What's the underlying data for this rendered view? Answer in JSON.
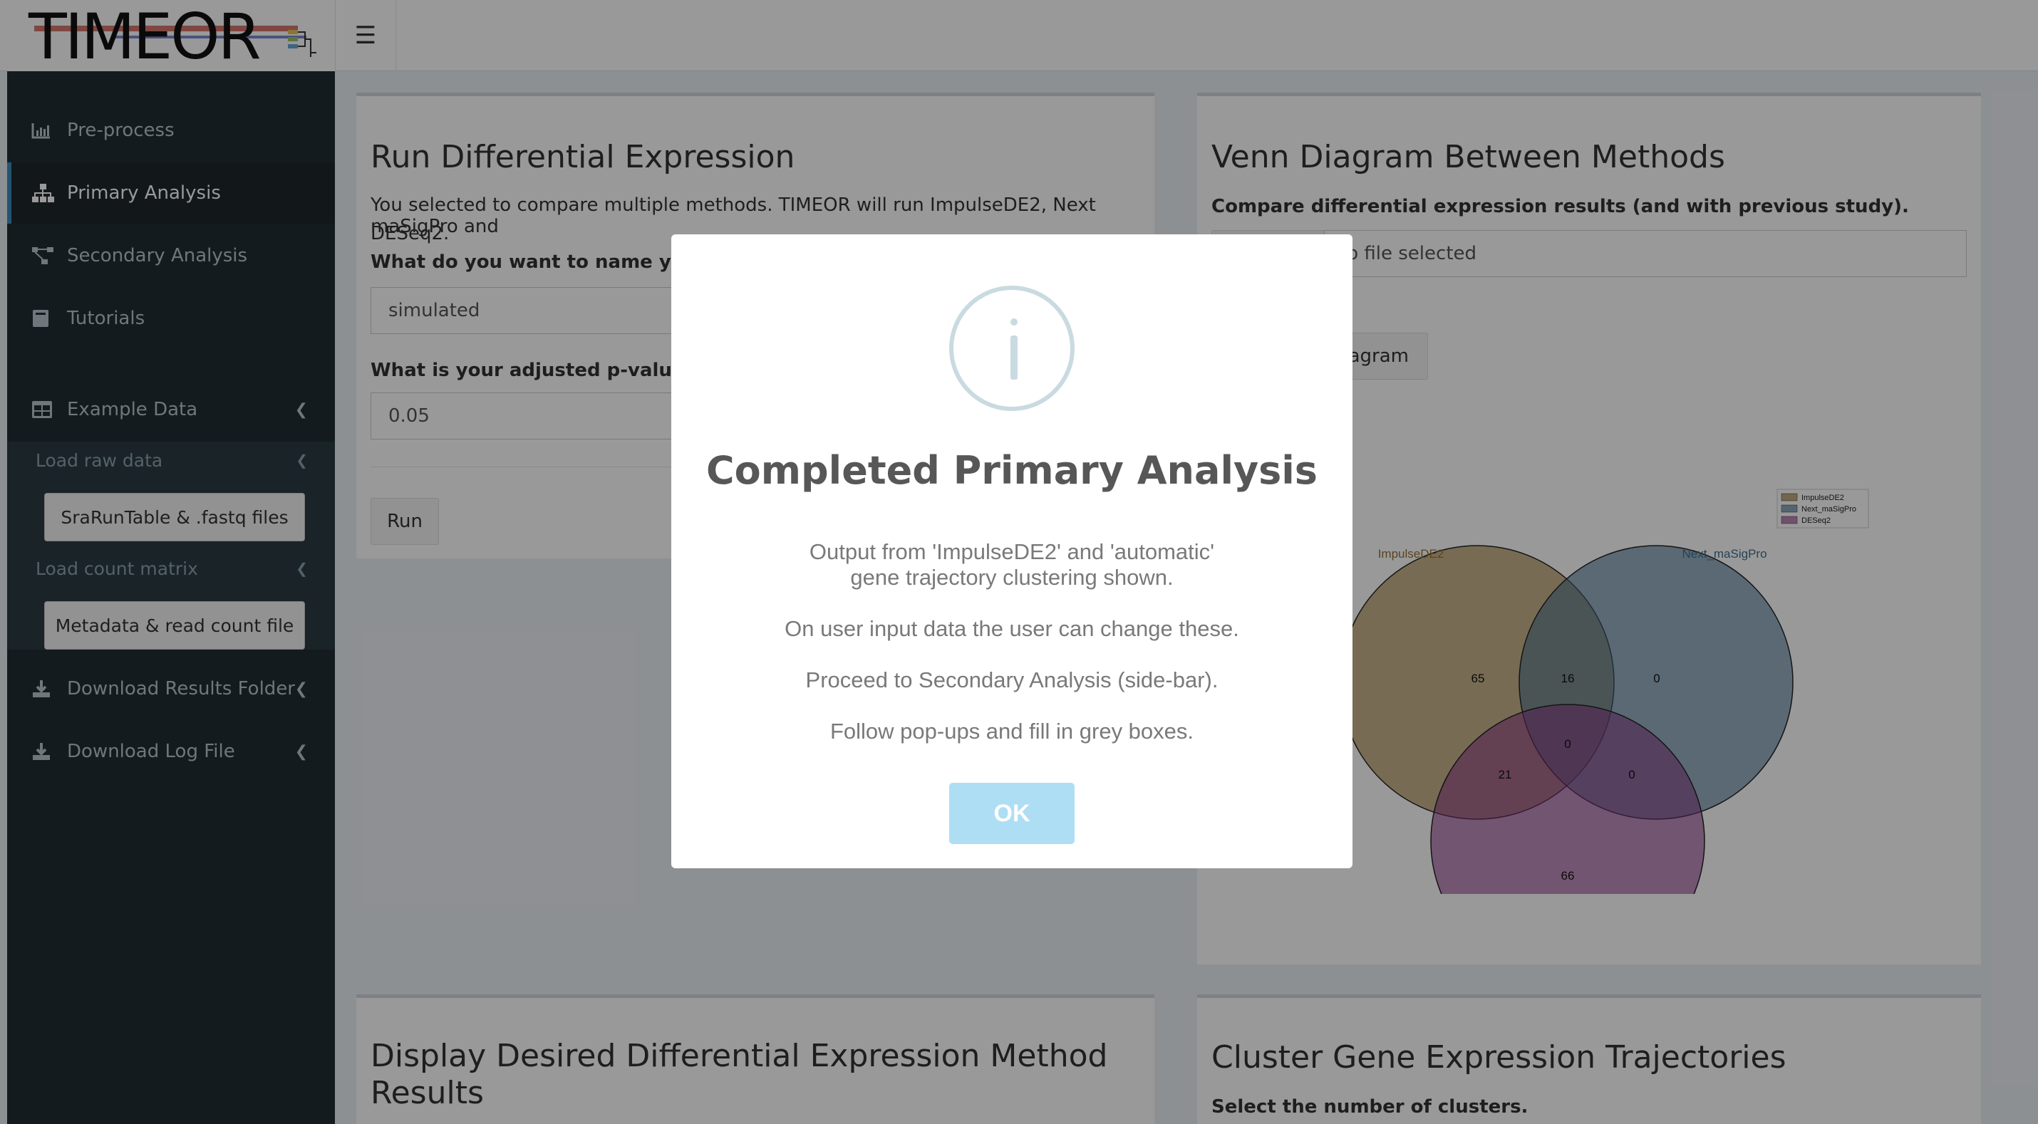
{
  "app": {
    "logo_text": "TIMEOR"
  },
  "sidebar": {
    "items": [
      {
        "label": "Pre-process"
      },
      {
        "label": "Primary Analysis"
      },
      {
        "label": "Secondary Analysis"
      },
      {
        "label": "Tutorials"
      },
      {
        "label": "Example Data"
      },
      {
        "label": "Download Results Folder"
      },
      {
        "label": "Download Log File"
      }
    ],
    "example": {
      "load_raw_label": "Load raw data",
      "raw_button": "SraRunTable & .fastq files",
      "load_count_label": "Load count matrix",
      "count_button": "Metadata & read count file"
    }
  },
  "de_box": {
    "title": "Run Differential Expression",
    "description_1": "You selected to compare multiple methods. TIMEOR will run ImpulseDE2, Next maSigPro and",
    "description_2": "DESeq2.",
    "name_question": "What do you want to name your re",
    "name_value": "simulated",
    "pval_question": "What is your adjusted p-value thre",
    "pval_value": "0.05",
    "run_button": "Run"
  },
  "venn_box": {
    "title": "Venn Diagram Between Methods",
    "subtitle": "Compare differential expression results (and with previous study).",
    "file_placeholder": "lo file selected",
    "diagram_button": "iagram"
  },
  "chart_data": {
    "type": "venn",
    "sets": [
      "ImpulseDE2",
      "Next_maSigPro",
      "DESeq2"
    ],
    "regions": {
      "ImpulseDE2_only": 65,
      "Next_maSigPro_only": 0,
      "DESeq2_only": 66,
      "ImpulseDE2_Next_maSigPro": 16,
      "ImpulseDE2_DESeq2": 21,
      "Next_maSigPro_DESeq2": 0,
      "all_three": 0
    },
    "legend": [
      "ImpulseDE2",
      "Next_maSigPro",
      "DESeq2"
    ],
    "legend_position": "top-right",
    "colors": {
      "ImpulseDE2": "#9a7230",
      "Next_maSigPro": "#3f6f90",
      "DESeq2": "#8b3586"
    }
  },
  "display_box": {
    "title_1": "Display Desired Differential Expression Method",
    "title_2": "Results"
  },
  "cluster_box": {
    "title": "Cluster Gene Expression Trajectories",
    "subtitle": "Select the number of clusters."
  },
  "modal": {
    "title": "Completed Primary Analysis",
    "line_1": "Output from 'ImpulseDE2' and 'automatic'",
    "line_2": "gene trajectory clustering shown.",
    "line_3": "On user input data the user can change these.",
    "line_4": "Proceed to Secondary Analysis (side-bar).",
    "line_5": "Follow pop-ups and fill in grey boxes.",
    "ok_button": "OK"
  }
}
